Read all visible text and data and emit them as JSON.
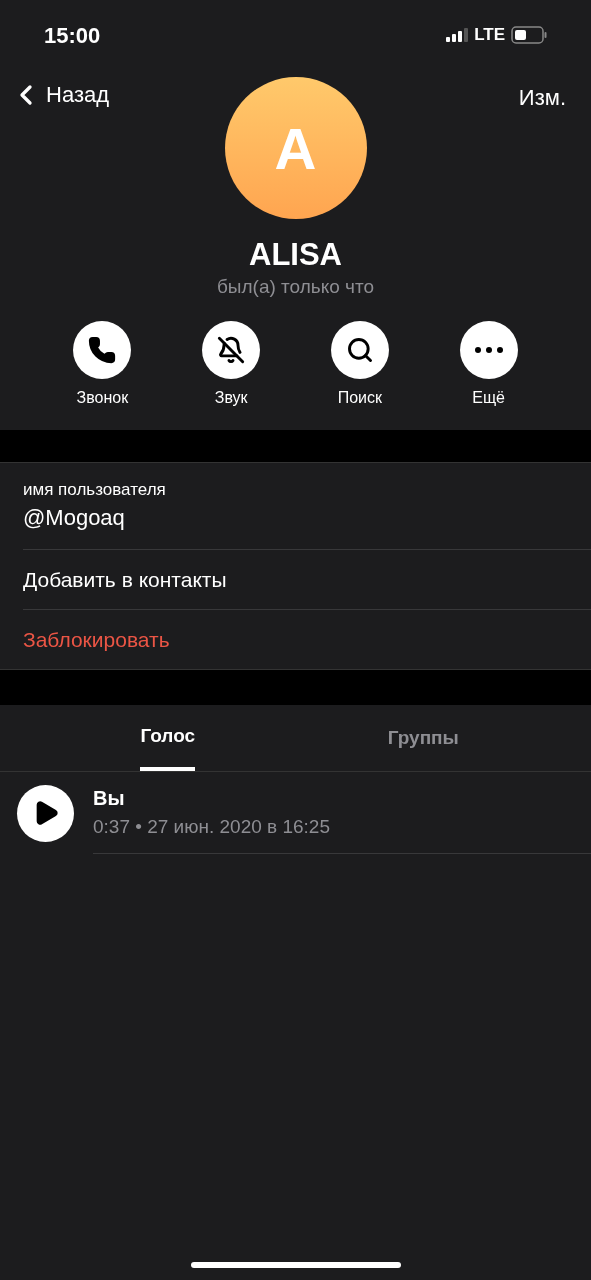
{
  "status_bar": {
    "time": "15:00",
    "network": "LTE"
  },
  "nav": {
    "back": "Назад",
    "edit": "Изм."
  },
  "profile": {
    "initial": "A",
    "name": "ALISA",
    "status": "был(а) только что"
  },
  "actions": [
    {
      "kind": "call",
      "label": "Звонок"
    },
    {
      "kind": "mute",
      "label": "Звук"
    },
    {
      "kind": "search",
      "label": "Поиск"
    },
    {
      "kind": "more",
      "label": "Ещё"
    }
  ],
  "info_rows": [
    {
      "kind": "field",
      "label": "имя пользователя",
      "value": "@Mogoaq"
    },
    {
      "kind": "action",
      "label": "Добавить в контакты"
    },
    {
      "kind": "destructive",
      "label": "Заблокировать"
    }
  ],
  "tabs": [
    {
      "label": "Голос",
      "selected": true
    },
    {
      "label": "Группы",
      "selected": false
    }
  ],
  "voice_messages": [
    {
      "sender": "Вы",
      "meta": "0:37 • 27 июн. 2020 в 16:25"
    }
  ]
}
